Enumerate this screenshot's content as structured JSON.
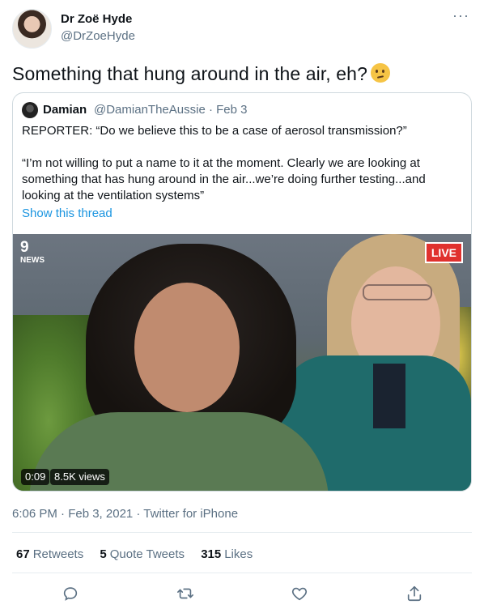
{
  "author": {
    "name": "Dr Zoë Hyde",
    "handle": "@DrZoeHyde"
  },
  "tweet": {
    "text": "Something that hung around in the air, eh?",
    "emoji_name": "thinking-face-emoji"
  },
  "quote": {
    "name": "Damian",
    "handle": "@DamianTheAussie",
    "date": "Feb 3",
    "lines": [
      "REPORTER: “Do we believe this to be a case of aerosol transmission?”",
      "“I’m not willing to put a name to it at the moment. Clearly we are looking at",
      "something that has hung around in the air...we’re doing further testing...and",
      "looking at the ventilation systems”"
    ],
    "show_thread": "Show this thread",
    "video": {
      "logo": "9",
      "logo_sub": "NEWS",
      "live": "LIVE",
      "duration": "0:09",
      "views": "8.5K views"
    }
  },
  "timestamp": "6:06 PM · Feb 3, 2021 · Twitter for iPhone",
  "stats": {
    "retweets_count": "67",
    "retweets_label": "Retweets",
    "quotes_count": "5",
    "quotes_label": "Quote Tweets",
    "likes_count": "315",
    "likes_label": "Likes"
  },
  "actions": [
    "reply-icon",
    "retweet-icon",
    "like-icon",
    "share-icon"
  ],
  "colors": {
    "link": "#1b95e0",
    "secondary": "#5b7083",
    "live_red": "#e0312e"
  }
}
